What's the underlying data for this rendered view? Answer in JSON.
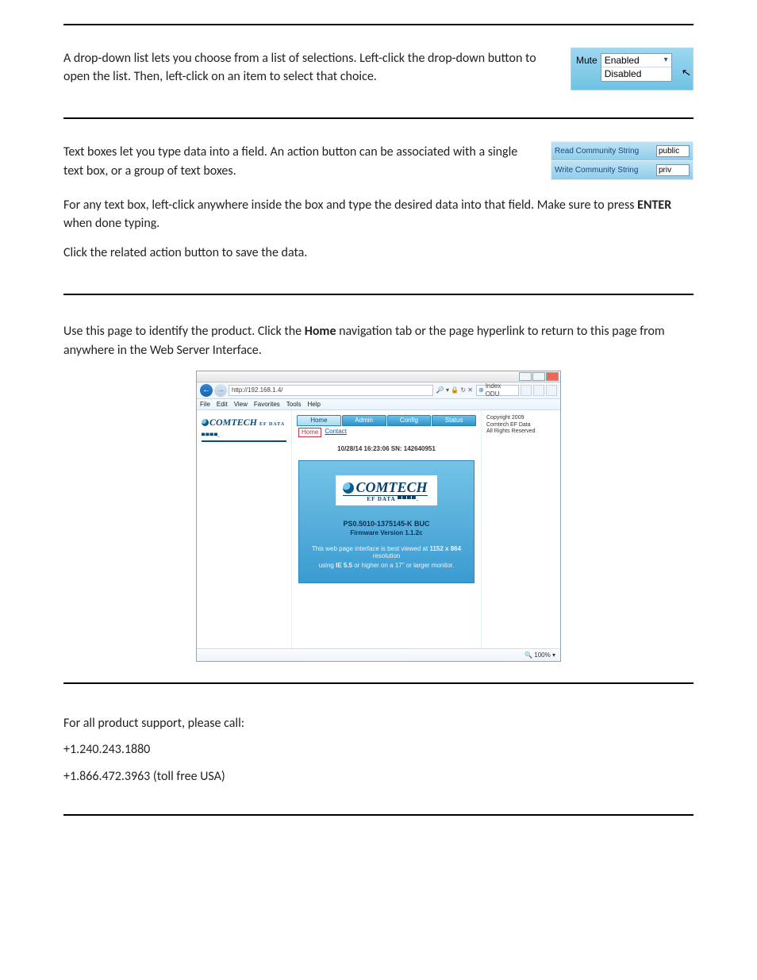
{
  "s1": {
    "text": "A drop-down list lets you choose from a list of selections. Left-click the drop-down button to open the list. Then, left-click on an item to select that choice.",
    "example": {
      "label": "Mute",
      "options": [
        "Enabled",
        "Disabled"
      ]
    }
  },
  "s2": {
    "p1": "Text boxes let you type data into a field. An action button can be associated with a single text box, or a group of text boxes.",
    "p2a": "For any text box, left-click anywhere inside the box and type the desired data into that field. Make sure to press ",
    "p2b": "ENTER",
    "p2c": " when done typing.",
    "p3": "Click the related action button to save the data.",
    "example": {
      "rows": [
        {
          "label": "Read Community String",
          "value": "public"
        },
        {
          "label": "Write Community String",
          "value": "priv"
        }
      ]
    }
  },
  "s3": {
    "p1a": "Use this page to identify the product. Click the ",
    "p1b": "Home",
    "p1c": " navigation tab or the page hyperlink to return to this page from anywhere in the Web Server Interface.",
    "browser": {
      "url": "http://192.168.1.4/",
      "tabTitle": "Index ODU",
      "menus": [
        "File",
        "Edit",
        "View",
        "Favorites",
        "Tools",
        "Help"
      ],
      "brand": "COMTECH",
      "brandSub": "EF DATA ▀▀▀▀.",
      "tabs": [
        "Home",
        "Admin",
        "Config",
        "Status"
      ],
      "subHome": "Home",
      "subContact": "Contact",
      "datetime": "10/28/14  16:23:06  SN: 142640951",
      "card": {
        "brand": "COMTECH",
        "brandSub": "EF DATA ▀▀▀▀.",
        "model": "PS0.5010-1375145-K BUC",
        "fw": "Firmware Version 1.1.2c",
        "note1a": "This web page interface is best viewed at ",
        "note1b": "1152 x 864",
        "note1c": " resolution",
        "note2a": "using ",
        "note2b": "IE 5.5",
        "note2c": " or higher on a 17\" or larger monitor."
      },
      "copyright": [
        "Copyright 2009",
        "Comtech EF Data",
        "All Rights Reserved"
      ],
      "zoom": "100%"
    }
  },
  "s4": {
    "p1": "For all product support, please call:",
    "p2": "+1.240.243.1880",
    "p3": "+1.866.472.3963 (toll free USA)"
  }
}
